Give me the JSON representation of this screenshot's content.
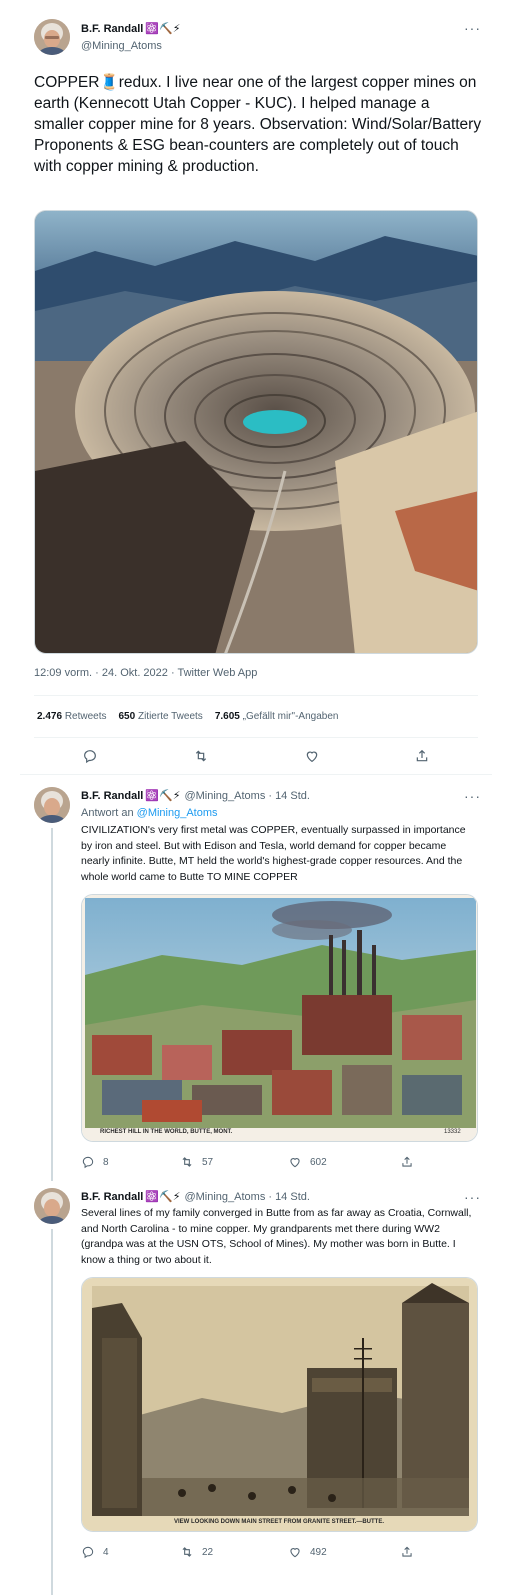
{
  "main_tweet": {
    "author_name": "B.F. Randall",
    "author_emojis": "⚛️⛏️⚡",
    "author_handle": "@Mining_Atoms",
    "text": "COPPER🧵redux. I live near one of the largest copper mines on earth (Kennecott Utah Copper - KUC). I helped manage a smaller copper mine for 8 years. Observation: Wind/Solar/Battery Proponents & ESG bean-counters are completely out of touch with copper mining & production.",
    "timestamp": "12:09 vorm. · 24. Okt. 2022 · Twitter Web App",
    "retweets_count": "2.476",
    "retweets_label": "Retweets",
    "quotes_count": "650",
    "quotes_label": "Zitierte Tweets",
    "likes_count": "7.605",
    "likes_label": "„Gefällt mir\"-Angaben"
  },
  "reply_1": {
    "author_name": "B.F. Randall",
    "author_emojis": "⚛️⛏️⚡",
    "author_handle": "@Mining_Atoms",
    "time": "· 14 Std.",
    "reply_to_label": "Antwort an",
    "reply_to_handle": "@Mining_Atoms",
    "text": "CIVILIZATION's very first metal was COPPER, eventually surpassed in importance by iron and steel. But with Edison and Tesla, world demand for copper became nearly infinite. Butte, MT held the world's highest-grade copper resources. And the whole world came to Butte TO MINE COPPER",
    "image_caption": "RICHEST HILL IN THE WORLD, BUTTE, MONT.",
    "image_number": "13332",
    "replies": "8",
    "retweets": "57",
    "likes": "602"
  },
  "reply_2": {
    "author_name": "B.F. Randall",
    "author_emojis": "⚛️⛏️⚡",
    "author_handle": "@Mining_Atoms",
    "time": "· 14 Std.",
    "text": "Several lines of my family converged in Butte from as far away as Croatia, Cornwall, and North Carolina - to mine copper. My grandparents met there during WW2 (grandpa was at the USN OTS, School of Mines). My mother was born in Butte. I know a thing or two about it.",
    "image_caption": "VIEW LOOKING DOWN MAIN STREET FROM GRANITE STREET.—BUTTE.",
    "replies": "4",
    "retweets": "22",
    "likes": "492"
  },
  "icons": {
    "more": "more-icon",
    "reply": "reply-icon",
    "retweet": "retweet-icon",
    "like": "like-icon",
    "share": "share-icon"
  },
  "colors": {
    "accent": "#1d9bf0",
    "muted": "#536471",
    "border": "#cfd9de"
  }
}
